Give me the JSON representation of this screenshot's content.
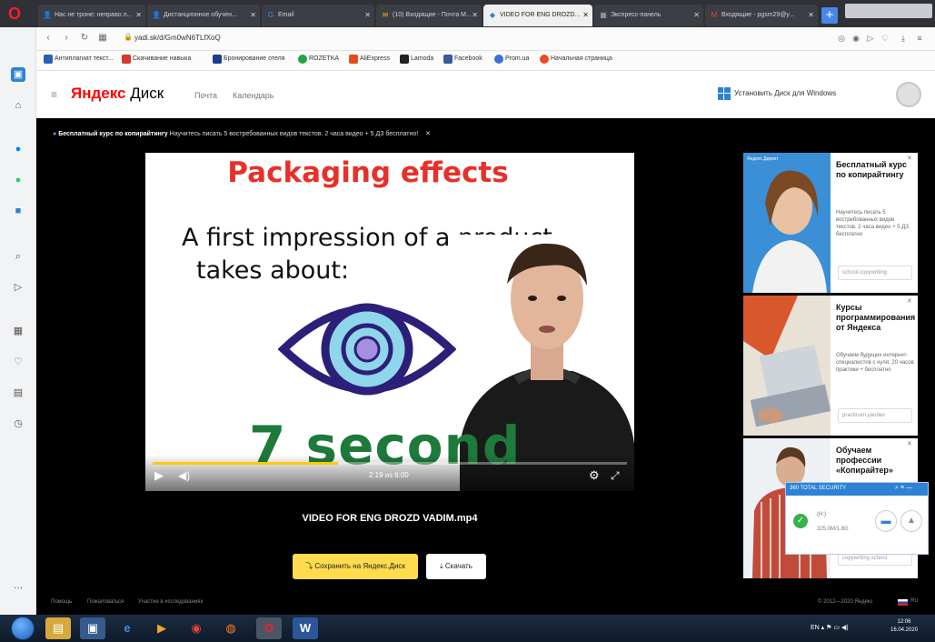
{
  "browser": {
    "tabs": [
      {
        "label": "Нас не троне: неправо л...",
        "icon": "user-icon"
      },
      {
        "label": "Дистанционное обучен...",
        "icon": "user-icon"
      },
      {
        "label": "Email",
        "icon": "google-icon"
      },
      {
        "label": "(10) Входящие - Почта М...",
        "icon": "mail-icon"
      },
      {
        "label": "VIDEO FOR ENG DROZD...",
        "icon": "disk-icon"
      },
      {
        "label": "Экспресс-панель",
        "icon": "grid-icon"
      },
      {
        "label": "Входящие - pgsm29@y...",
        "icon": "gmail-icon"
      }
    ],
    "url": "yadi.sk/d/Gm0wN6TLfXoQ",
    "bookmarks": [
      {
        "label": "Антиплагиат текст...",
        "color": "#2b5fb4"
      },
      {
        "label": "Скачивание навыка",
        "color": "#d33a2c"
      },
      {
        "label": "Бронирование отеля",
        "color": "#1b3d8c"
      },
      {
        "label": "ROZETKA",
        "color": "#25a244"
      },
      {
        "label": "AliExpress",
        "color": "#e24e1b"
      },
      {
        "label": "Lamoda",
        "color": "#222"
      },
      {
        "label": "Facebook",
        "color": "#3b5998"
      },
      {
        "label": "Prom.ua",
        "color": "#3e6fd8"
      },
      {
        "label": "Начальная страница",
        "color": "#ef4b24"
      }
    ]
  },
  "header": {
    "logo_ya": "Яндекс",
    "logo_disk": "Диск",
    "nav_mail": "Почта",
    "nav_calendar": "Календарь",
    "install_windows": "Установить Диск для Windows"
  },
  "promo": {
    "bold": "Бесплатный курс по копирайтингу",
    "text": "Научитесь писать 5 востребованных видов текстов. 2 часа видео + 5 ДЗ бесплатно!",
    "close": "✕"
  },
  "video": {
    "title": "Packaging effects",
    "line1": "A first impression of a product",
    "line2": "takes about:",
    "emphasis": "7 second",
    "time": "2:19 из 6:00",
    "progress": 0.39
  },
  "file": {
    "name": "VIDEO FOR ENG DROZD VADIM.mp4",
    "save_label": "Сохранить на Яндекс.Диск",
    "download_label": "Скачать"
  },
  "ads": [
    {
      "title": "Бесплатный курс по копирайтингу",
      "text": "Научитесь писать 5 востребованных видов текстов. 2 часа видео + 5 ДЗ бесплатно",
      "link": "school.copywriting"
    },
    {
      "title": "Курсы программирования от Яндекса",
      "text": "Обучаем будущих интернет-специалистов с нуля: 20 часов практики + бесплатно",
      "link": "practicum.yandex"
    },
    {
      "title": "Обучаем профессии «Копирайтер»",
      "text": "",
      "link": "copywriting.school"
    }
  ],
  "security": {
    "title": "360 TOTAL SECURITY",
    "line1": "(H:)",
    "line2": "325.0M/1.8G"
  },
  "footer": {
    "links": [
      "Помощь",
      "Пожаловаться",
      "Участие в исследованиях"
    ],
    "copyright": "© 2012—2020 Яндекс",
    "lang": "RU"
  },
  "taskbar": {
    "lang": "EN",
    "time": "12:06",
    "date": "16.04.2020"
  },
  "colors": {
    "accent": "#ffdb4d",
    "title_red": "#e8302a",
    "emphasis_green": "#1d7a3a",
    "eye_navy": "#2b1f7a",
    "eye_iris": "#8fd6ea"
  }
}
